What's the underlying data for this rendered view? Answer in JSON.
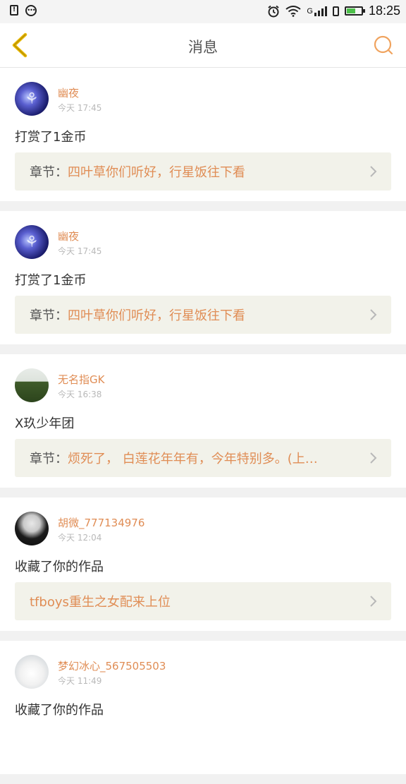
{
  "status_bar": {
    "time": "18:25",
    "network_label": "G"
  },
  "nav": {
    "title": "消息"
  },
  "messages": [
    {
      "username": "幽夜",
      "time": "今天 17:45",
      "action": "打赏了1金币",
      "ref_prefix": "章节：",
      "ref_title": "四叶草你们听好，行星饭往下看"
    },
    {
      "username": "幽夜",
      "time": "今天 17:45",
      "action": "打赏了1金币",
      "ref_prefix": "章节：",
      "ref_title": "四叶草你们听好，行星饭往下看"
    },
    {
      "username": "无名指GK",
      "time": "今天 16:38",
      "action": "X玖少年团",
      "ref_prefix": "章节：",
      "ref_title": "烦死了， 白莲花年年有，今年特别多。(上…"
    },
    {
      "username": "胡微_777134976",
      "time": "今天 12:04",
      "action": "收藏了你的作品",
      "ref_prefix": "",
      "ref_title": "tfboys重生之女配来上位"
    },
    {
      "username": "梦幻冰心_567505503",
      "time": "今天 11:49",
      "action": "收藏了你的作品"
    }
  ],
  "colors": {
    "accent": "#e08d55",
    "back_icon": "#e8b800",
    "ref_background": "#f2f2ea"
  }
}
